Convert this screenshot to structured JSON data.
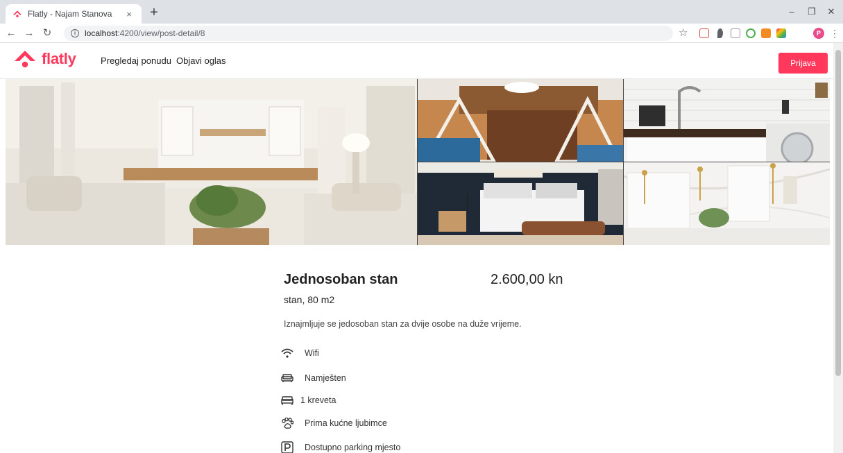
{
  "browser": {
    "tab_title": "Flatly - Najam Stanova",
    "tab_close": "×",
    "new_tab": "+",
    "url_host": "localhost",
    "url_path": ":4200/view/post-detail/8",
    "profile_initial": "P",
    "minimize": "–",
    "restore": "❐",
    "close": "✕"
  },
  "navbar": {
    "brand": "flatly",
    "links": [
      "Pregledaj ponudu",
      "Objavi oglas"
    ],
    "login_label": "Prijava"
  },
  "listing": {
    "title": "Jednosoban stan",
    "price": "2.600,00 kn",
    "subtitle": "stan, 80 m2",
    "description": "Iznajmljuje se jedosoban stan za dvije osobe na duže vrijeme.",
    "amenities": [
      {
        "icon": "wifi-icon",
        "label": "Wifi"
      },
      {
        "icon": "sofa-icon",
        "label": "Namješten"
      },
      {
        "icon": "bed-icon",
        "label": "1 kreveta"
      },
      {
        "icon": "paw-icon",
        "label": "Prima kućne ljubimce"
      },
      {
        "icon": "parking-icon",
        "label": "Dostupno parking mjesto"
      }
    ]
  },
  "colors": {
    "brand": "#ff385c",
    "tabbar": "#dee1e6"
  }
}
